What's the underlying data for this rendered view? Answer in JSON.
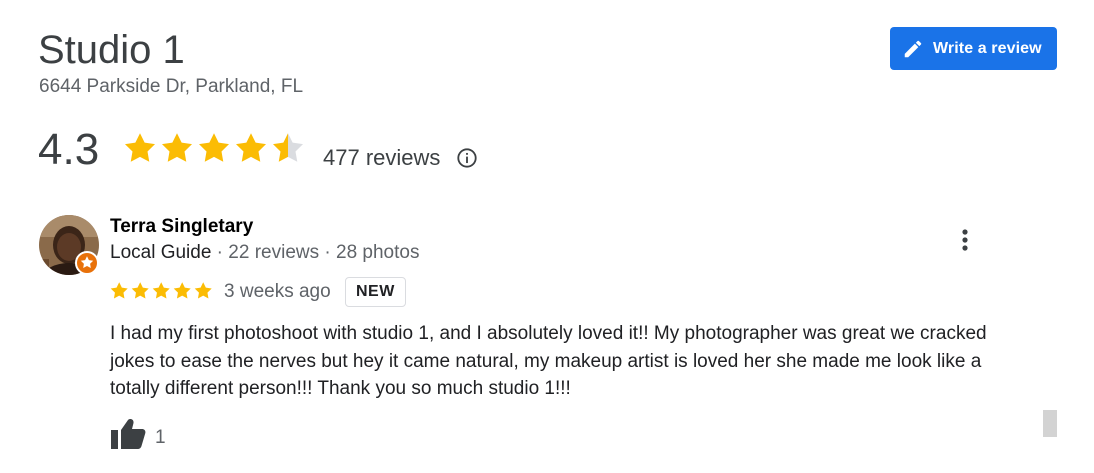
{
  "place": {
    "name": "Studio 1",
    "address": "6644 Parkside Dr, Parkland, FL",
    "write_review_label": "Write a review"
  },
  "summary": {
    "rating": "4.3",
    "rating_value": 4.3,
    "review_count": "477 reviews",
    "star_color": "#fbbc04"
  },
  "review": {
    "author": "Terra Singletary",
    "author_badge": "Local Guide",
    "meta_reviews": "22 reviews",
    "meta_photos": "28 photos",
    "meta_sep": " · ",
    "stars": 5,
    "date": "3 weeks ago",
    "new_badge": "NEW",
    "text": "I had my first photoshoot with studio 1, and I absolutely loved it!! My photographer was great we cracked jokes to ease the nerves but hey it came natural, my makeup artist is loved her she made me look like a totally different person!!! Thank you so much studio 1!!!",
    "likes": "1"
  },
  "colors": {
    "accent": "#1a73e8",
    "badge_orange": "#e8710a"
  },
  "icons": {
    "write": "pencil-icon",
    "info": "info-icon",
    "more": "more-vert-icon",
    "like": "thumbs-up-icon",
    "badge": "local-guide-star-icon"
  }
}
